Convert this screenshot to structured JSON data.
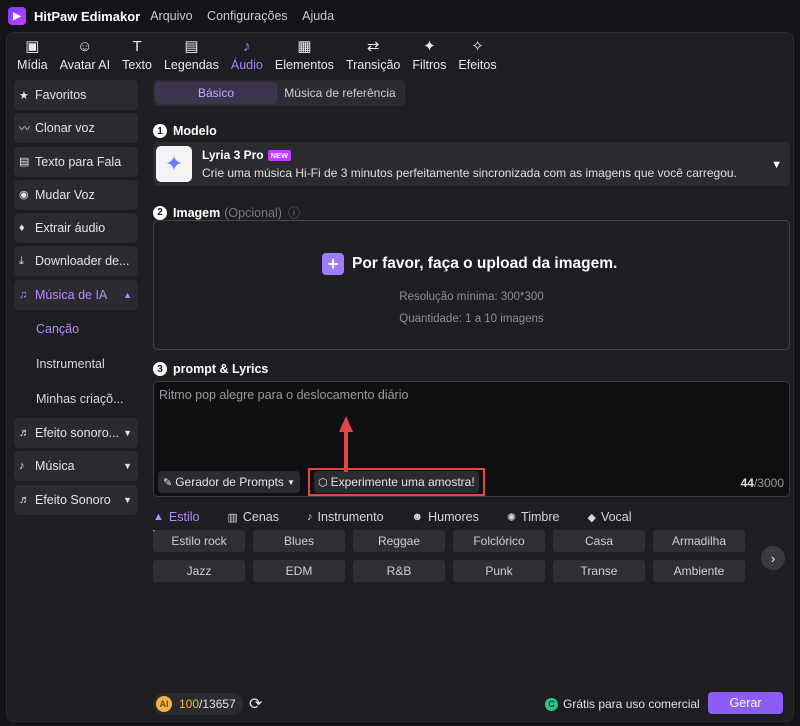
{
  "app": {
    "title": "HitPaw Edimakor",
    "menu": [
      "Arquivo",
      "Configurações",
      "Ajuda"
    ]
  },
  "toolbar": [
    {
      "label": "Mídia",
      "icon": "media-icon",
      "glyph": "▣"
    },
    {
      "label": "Avatar AI",
      "icon": "avatar-icon",
      "glyph": "☺"
    },
    {
      "label": "Texto",
      "icon": "text-icon",
      "glyph": "T"
    },
    {
      "label": "Legendas",
      "icon": "captions-icon",
      "glyph": "▤"
    },
    {
      "label": "Áudio",
      "icon": "audio-icon",
      "glyph": "♪",
      "active": true
    },
    {
      "label": "Elementos",
      "icon": "elements-icon",
      "glyph": "▦"
    },
    {
      "label": "Transição",
      "icon": "transition-icon",
      "glyph": "⇄"
    },
    {
      "label": "Filtros",
      "icon": "filters-icon",
      "glyph": "✦"
    },
    {
      "label": "Efeitos",
      "icon": "effects-icon",
      "glyph": "✧"
    }
  ],
  "sidebar": {
    "items": [
      {
        "label": "Favoritos",
        "icon": "star-icon",
        "glyph": "★"
      },
      {
        "label": "Clonar voz",
        "icon": "voice-wave-icon",
        "glyph": "〰"
      },
      {
        "label": "Texto para Fala",
        "icon": "tts-icon",
        "glyph": "▤"
      },
      {
        "label": "Mudar Voz",
        "icon": "voice-change-icon",
        "glyph": "◉"
      },
      {
        "label": "Extrair áudio",
        "icon": "mic-icon",
        "glyph": "♦"
      },
      {
        "label": "Downloader de...",
        "icon": "download-icon",
        "glyph": "⤓"
      }
    ],
    "ai_music": {
      "label": "Música de IA",
      "icon": "ai-music-icon",
      "glyph": "♫",
      "caret": "▲"
    },
    "sub_items": [
      "Canção",
      "Instrumental",
      "Minhas criaçõ..."
    ],
    "bottom_items": [
      {
        "label": "Efeito sonoro...",
        "icon": "sound-fx-icon",
        "glyph": "♬",
        "caret": "▼"
      },
      {
        "label": "Música",
        "icon": "music-icon",
        "glyph": "♪",
        "caret": "▼"
      },
      {
        "label": "Efeito Sonoro",
        "icon": "sound-effect-icon",
        "glyph": "♬",
        "caret": "▼"
      }
    ]
  },
  "tabs": {
    "basic": "Básico",
    "reference": "Música de referência"
  },
  "model": {
    "section_num": "1",
    "section_label": "Modelo",
    "name": "Lyria 3 Pro",
    "badge": "NEW",
    "description": "Crie uma música Hi-Fi de 3 minutos perfeitamente sincronizada com as imagens que você carregou."
  },
  "image": {
    "section_num": "2",
    "section_label": "Imagem",
    "optional": "(Opcional)",
    "upload_text": "Por favor, faça o upload da imagem.",
    "resolution": "Resolução mínima: 300*300",
    "quantity": "Quantidade: 1 a 10 imagens"
  },
  "prompt": {
    "section_num": "3",
    "section_label": "prompt & Lyrics",
    "text": "Ritmo pop alegre para o deslocamento diário",
    "generator_label": "Gerador de Prompts",
    "sample_label": "Experimente uma amostra!",
    "count_current": "44",
    "count_max": "/3000"
  },
  "category_tabs": [
    {
      "label": "Estilo",
      "icon": "style-icon",
      "glyph": "▲",
      "active": true
    },
    {
      "label": "Cenas",
      "icon": "scenes-icon",
      "glyph": "▥"
    },
    {
      "label": "Instrumento",
      "icon": "guitar-icon",
      "glyph": "♪"
    },
    {
      "label": "Humores",
      "icon": "mood-icon",
      "glyph": "☻"
    },
    {
      "label": "Timbre",
      "icon": "timbre-icon",
      "glyph": "✺"
    },
    {
      "label": "Vocal",
      "icon": "vocal-icon",
      "glyph": "◆"
    }
  ],
  "chips": {
    "row1": [
      "Estilo rock",
      "Blues",
      "Reggae",
      "Folclórico",
      "Casa",
      "Armadilha"
    ],
    "row2": [
      "Jazz",
      "EDM",
      "R&B",
      "Punk",
      "Transe",
      "Ambiente"
    ]
  },
  "footer": {
    "credits_used": "100",
    "credits_total": "/13657",
    "commercial_label": "Grátis para uso comercial",
    "generate_label": "Gerar"
  },
  "colors": {
    "accent": "#a880ff",
    "generate": "#8b5cf6",
    "highlight_border": "#e04646",
    "coin": "#f0b44a"
  }
}
